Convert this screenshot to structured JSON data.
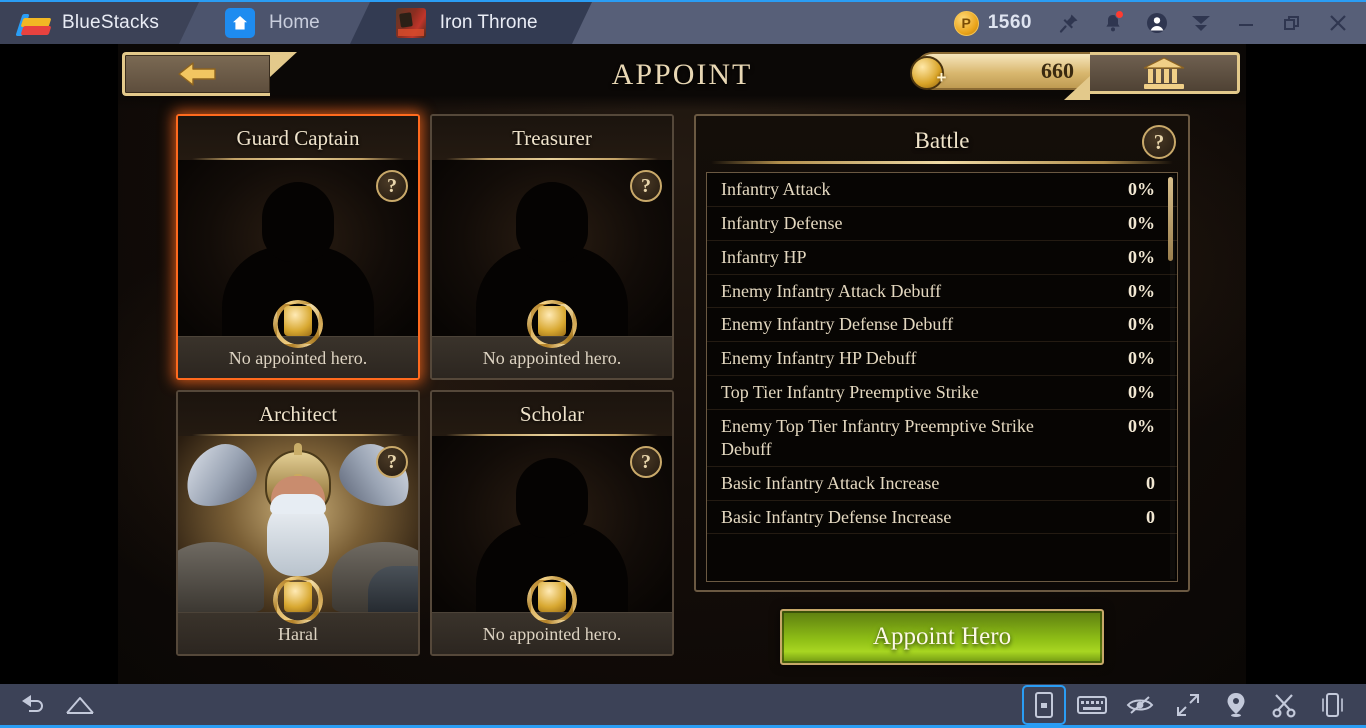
{
  "titlebar": {
    "brand": "BlueStacks",
    "tabs": [
      {
        "label": "Home",
        "icon": "home-icon"
      },
      {
        "label": "Iron Throne",
        "icon": "game-app-icon"
      }
    ],
    "points": "1560",
    "point_icon": "coin-icon",
    "actions": [
      {
        "name": "pin-icon"
      },
      {
        "name": "notifications-bell-icon"
      },
      {
        "name": "user-account-icon"
      },
      {
        "name": "more-menu-icon"
      }
    ],
    "window_controls": [
      {
        "name": "minimize-button",
        "glyph": "—"
      },
      {
        "name": "restore-button",
        "glyph": "❐"
      },
      {
        "name": "close-button",
        "glyph": "✕"
      }
    ]
  },
  "game": {
    "title": "APPOINT",
    "back_label": "back-arrow",
    "gold": "660",
    "bank_label": "bank-icon",
    "cards": [
      {
        "title": "Guard Captain",
        "status": "No appointed hero.",
        "badge": "shield-badge-icon",
        "selected": true,
        "has_portrait": false,
        "help": "?"
      },
      {
        "title": "Treasurer",
        "status": "No appointed hero.",
        "badge": "scales-badge-icon",
        "selected": false,
        "has_portrait": false,
        "help": "?"
      },
      {
        "title": "Architect",
        "status": "Haral",
        "badge": "hammer-badge-icon",
        "selected": false,
        "has_portrait": true,
        "help": "?"
      },
      {
        "title": "Scholar",
        "status": "No appointed hero.",
        "badge": "book-badge-icon",
        "selected": false,
        "has_portrait": false,
        "help": "?"
      }
    ],
    "battle": {
      "title": "Battle",
      "help": "?",
      "stats": [
        {
          "label": "Infantry Attack",
          "value": "0%"
        },
        {
          "label": "Infantry Defense",
          "value": "0%"
        },
        {
          "label": "Infantry HP",
          "value": "0%"
        },
        {
          "label": "Enemy Infantry Attack Debuff",
          "value": "0%"
        },
        {
          "label": "Enemy Infantry Defense Debuff",
          "value": "0%"
        },
        {
          "label": "Enemy Infantry HP Debuff",
          "value": "0%"
        },
        {
          "label": "Top Tier Infantry Preemptive Strike",
          "value": "0%"
        },
        {
          "label": "Enemy Top Tier Infantry Preemptive Strike Debuff",
          "value": "0%"
        },
        {
          "label": "Basic Infantry Attack Increase",
          "value": "0"
        },
        {
          "label": "Basic Infantry Defense Increase",
          "value": "0"
        }
      ]
    },
    "appoint_button": "Appoint Hero"
  },
  "bottombar": {
    "left": [
      {
        "name": "back-nav-icon"
      },
      {
        "name": "home-nav-icon"
      }
    ],
    "right": [
      {
        "name": "device-rotate-icon",
        "active": true
      },
      {
        "name": "keyboard-icon"
      },
      {
        "name": "eye-slash-icon"
      },
      {
        "name": "fullscreen-icon"
      },
      {
        "name": "location-pin-icon"
      },
      {
        "name": "scissors-icon"
      },
      {
        "name": "shake-device-icon"
      }
    ]
  },
  "colors": {
    "accent": "#2a9df4",
    "titlebar_bg": "#575f78",
    "selected_card_border": "#ff6a1e",
    "gold": "#e3c98b",
    "appoint_green": "#8fbf16"
  }
}
